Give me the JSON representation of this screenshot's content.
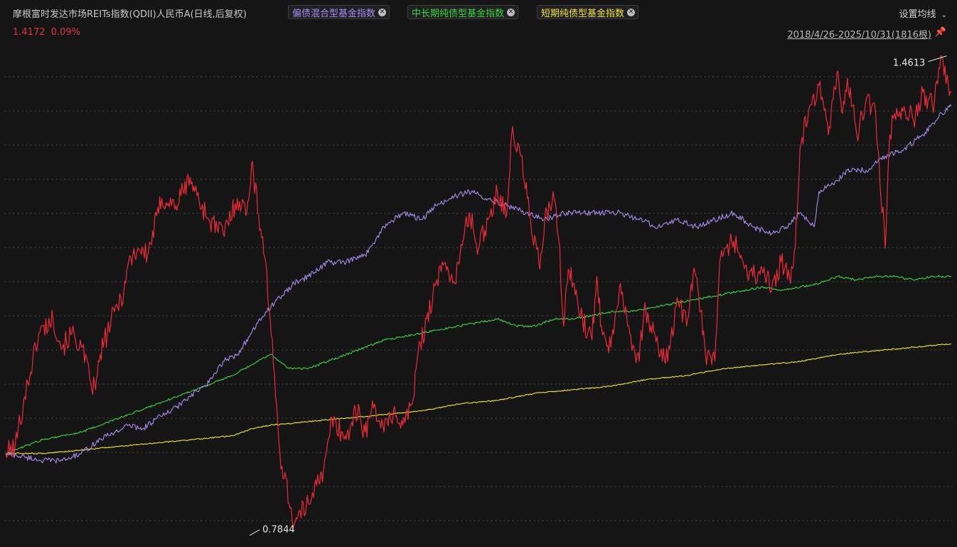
{
  "header": {
    "fund_name": "摩根富时发达市场REITs指数(QDII)人民币A(日线,后复权)",
    "compare_tags": [
      {
        "label": "偏债混合型基金指数",
        "color": "#a98bf0"
      },
      {
        "label": "中长期纯债型基金指数",
        "color": "#39d443"
      },
      {
        "label": "短期纯债型基金指数",
        "color": "#f2e52b"
      }
    ],
    "settings_label": "设置均线",
    "last_value": "1.4172",
    "change_pct": "0.09%",
    "date_range": "2018/4/26-2025/10/31(1816根)"
  },
  "chart_data": {
    "type": "line",
    "x_range": [
      "2018/4/26",
      "2025/10/31"
    ],
    "bars": 1816,
    "ylim": [
      0.775,
      1.48
    ],
    "grid": true,
    "annotations": {
      "max": {
        "label": "1.4613",
        "value": 1.4613
      },
      "min": {
        "label": "0.7844",
        "value": 0.7844
      }
    },
    "series": [
      {
        "name": "摩根富时发达市场REITs指数(QDII)人民币A",
        "color": "#ee2a36",
        "x": [
          0,
          0.01,
          0.02,
          0.035,
          0.05,
          0.06,
          0.07,
          0.08,
          0.09,
          0.095,
          0.1,
          0.115,
          0.125,
          0.13,
          0.14,
          0.15,
          0.165,
          0.18,
          0.195,
          0.2,
          0.215,
          0.23,
          0.245,
          0.255,
          0.26,
          0.275,
          0.29,
          0.305,
          0.32,
          0.33,
          0.335,
          0.345,
          0.355,
          0.36,
          0.365,
          0.37,
          0.375,
          0.38,
          0.385,
          0.39,
          0.4,
          0.41,
          0.42,
          0.43,
          0.435,
          0.445,
          0.455,
          0.465,
          0.475,
          0.485,
          0.49,
          0.5,
          0.51,
          0.52,
          0.53,
          0.535,
          0.545,
          0.555,
          0.565,
          0.57,
          0.58,
          0.585,
          0.59,
          0.595,
          0.6,
          0.61,
          0.62,
          0.625,
          0.63,
          0.64,
          0.645,
          0.65,
          0.66,
          0.67,
          0.675,
          0.68,
          0.69,
          0.7,
          0.71,
          0.72,
          0.725,
          0.73,
          0.735,
          0.74,
          0.75,
          0.755,
          0.76,
          0.77,
          0.78,
          0.79,
          0.8,
          0.805,
          0.81,
          0.82,
          0.83,
          0.835,
          0.84,
          0.85,
          0.86,
          0.87,
          0.875,
          0.88,
          0.885,
          0.89,
          0.9,
          0.91,
          0.92,
          0.93,
          0.935,
          0.94,
          0.95,
          0.96,
          0.97,
          0.98,
          0.99,
          1.0
        ],
        "y": [
          0.9,
          0.91,
          0.98,
          1.07,
          1.09,
          1.05,
          1.07,
          1.05,
          1.0,
          0.99,
          1.04,
          1.1,
          1.13,
          1.17,
          1.19,
          1.18,
          1.26,
          1.25,
          1.29,
          1.27,
          1.23,
          1.21,
          1.26,
          1.24,
          1.31,
          1.17,
          0.9,
          0.8,
          0.83,
          0.87,
          0.86,
          0.95,
          0.93,
          0.92,
          0.94,
          0.96,
          0.95,
          0.93,
          0.95,
          0.97,
          0.93,
          0.96,
          0.94,
          0.97,
          1.03,
          1.09,
          1.14,
          1.17,
          1.14,
          1.21,
          1.24,
          1.19,
          1.23,
          1.27,
          1.24,
          1.35,
          1.32,
          1.23,
          1.16,
          1.23,
          1.26,
          1.2,
          1.08,
          1.16,
          1.14,
          1.09,
          1.06,
          1.15,
          1.08,
          1.05,
          1.1,
          1.14,
          1.07,
          1.03,
          1.1,
          1.09,
          1.05,
          1.03,
          1.12,
          1.08,
          1.14,
          1.15,
          1.1,
          1.04,
          1.03,
          1.17,
          1.19,
          1.2,
          1.17,
          1.15,
          1.16,
          1.15,
          1.13,
          1.17,
          1.14,
          1.19,
          1.33,
          1.39,
          1.42,
          1.35,
          1.4,
          1.44,
          1.38,
          1.43,
          1.35,
          1.4,
          1.38,
          1.19,
          1.35,
          1.38,
          1.39,
          1.37,
          1.41,
          1.39,
          1.46,
          1.41
        ]
      },
      {
        "name": "偏债混合型基金指数",
        "color": "#a98bf0",
        "x": [
          0,
          0.02,
          0.04,
          0.06,
          0.08,
          0.1,
          0.115,
          0.13,
          0.145,
          0.16,
          0.175,
          0.19,
          0.205,
          0.215,
          0.23,
          0.245,
          0.26,
          0.275,
          0.29,
          0.305,
          0.32,
          0.34,
          0.36,
          0.38,
          0.4,
          0.42,
          0.44,
          0.455,
          0.47,
          0.49,
          0.51,
          0.53,
          0.55,
          0.57,
          0.59,
          0.61,
          0.63,
          0.65,
          0.67,
          0.69,
          0.71,
          0.73,
          0.75,
          0.77,
          0.79,
          0.81,
          0.825,
          0.84,
          0.855,
          0.86,
          0.875,
          0.89,
          0.91,
          0.93,
          0.95,
          0.97,
          0.99,
          1.0
        ],
        "y": [
          0.9,
          0.895,
          0.89,
          0.89,
          0.9,
          0.92,
          0.93,
          0.94,
          0.935,
          0.95,
          0.96,
          0.975,
          0.99,
          1.0,
          1.03,
          1.04,
          1.07,
          1.1,
          1.12,
          1.14,
          1.15,
          1.17,
          1.17,
          1.18,
          1.22,
          1.24,
          1.23,
          1.25,
          1.26,
          1.27,
          1.26,
          1.25,
          1.24,
          1.23,
          1.24,
          1.24,
          1.24,
          1.24,
          1.23,
          1.22,
          1.23,
          1.22,
          1.23,
          1.24,
          1.22,
          1.21,
          1.22,
          1.24,
          1.22,
          1.27,
          1.28,
          1.3,
          1.3,
          1.32,
          1.33,
          1.35,
          1.38,
          1.39
        ]
      },
      {
        "name": "中长期纯债型基金指数",
        "color": "#39d443",
        "x": [
          0,
          0.02,
          0.04,
          0.06,
          0.08,
          0.1,
          0.12,
          0.14,
          0.16,
          0.18,
          0.2,
          0.22,
          0.24,
          0.26,
          0.28,
          0.29,
          0.3,
          0.32,
          0.34,
          0.36,
          0.38,
          0.4,
          0.42,
          0.44,
          0.46,
          0.48,
          0.5,
          0.52,
          0.54,
          0.56,
          0.58,
          0.6,
          0.62,
          0.64,
          0.66,
          0.68,
          0.7,
          0.72,
          0.74,
          0.76,
          0.78,
          0.8,
          0.82,
          0.84,
          0.86,
          0.88,
          0.9,
          0.92,
          0.94,
          0.96,
          0.98,
          1.0
        ],
        "y": [
          0.9,
          0.91,
          0.92,
          0.925,
          0.93,
          0.94,
          0.95,
          0.96,
          0.97,
          0.98,
          0.99,
          1.0,
          1.01,
          1.025,
          1.04,
          1.03,
          1.02,
          1.02,
          1.03,
          1.04,
          1.05,
          1.06,
          1.065,
          1.07,
          1.075,
          1.08,
          1.085,
          1.09,
          1.08,
          1.08,
          1.09,
          1.09,
          1.095,
          1.1,
          1.1,
          1.105,
          1.11,
          1.115,
          1.12,
          1.125,
          1.13,
          1.135,
          1.13,
          1.135,
          1.14,
          1.15,
          1.145,
          1.15,
          1.15,
          1.145,
          1.15,
          1.15
        ]
      },
      {
        "name": "短期纯债型基金指数",
        "color": "#f2e52b",
        "x": [
          0,
          0.04,
          0.08,
          0.12,
          0.16,
          0.2,
          0.24,
          0.26,
          0.28,
          0.32,
          0.36,
          0.4,
          0.44,
          0.48,
          0.52,
          0.56,
          0.6,
          0.64,
          0.68,
          0.72,
          0.76,
          0.8,
          0.84,
          0.88,
          0.92,
          0.96,
          1.0
        ],
        "y": [
          0.9,
          0.9,
          0.905,
          0.91,
          0.915,
          0.92,
          0.925,
          0.935,
          0.94,
          0.945,
          0.95,
          0.955,
          0.96,
          0.97,
          0.975,
          0.985,
          0.99,
          0.995,
          1.005,
          1.01,
          1.02,
          1.025,
          1.03,
          1.04,
          1.045,
          1.05,
          1.055
        ]
      }
    ]
  }
}
